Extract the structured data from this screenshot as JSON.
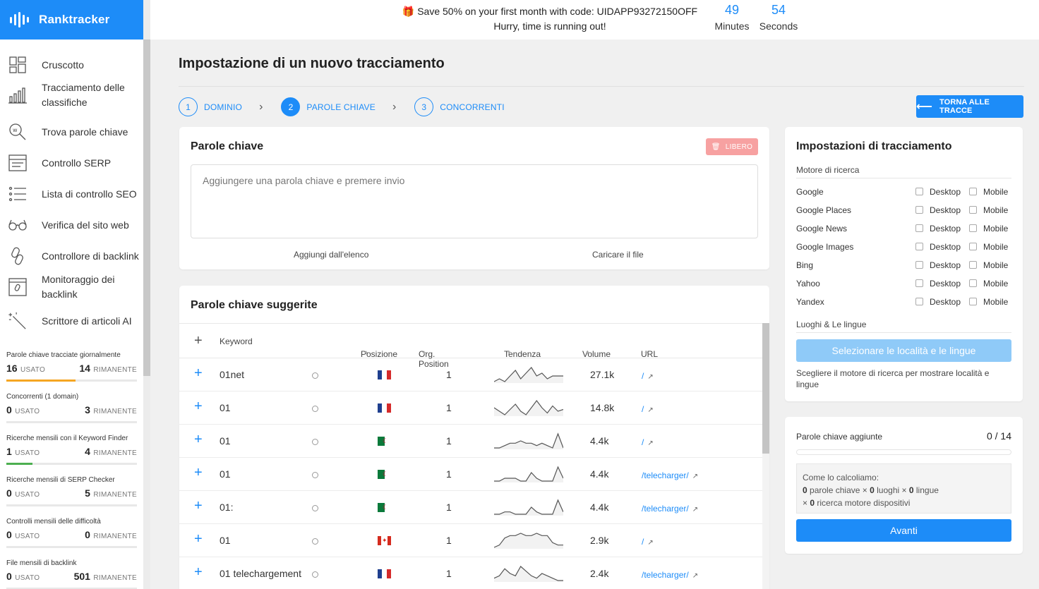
{
  "app": {
    "name": "Ranktracker"
  },
  "promo": {
    "line1": "Save 50% on your first month with code: UIDAPP93272150OFF",
    "line2": "Hurry, time is running out!",
    "minutes_value": "49",
    "minutes_label": "Minutes",
    "seconds_value": "54",
    "seconds_label": "Seconds"
  },
  "sidebar": {
    "items": [
      {
        "label": "Cruscotto",
        "icon": "dashboard-icon"
      },
      {
        "label": "Tracciamento delle classifiche",
        "icon": "bar-chart-icon"
      },
      {
        "label": "Trova parole chiave",
        "icon": "keyword-search-icon"
      },
      {
        "label": "Controllo SERP",
        "icon": "serp-icon"
      },
      {
        "label": "Lista di controllo SEO",
        "icon": "checklist-icon"
      },
      {
        "label": "Verifica del sito web",
        "icon": "glasses-icon"
      },
      {
        "label": "Controllore di backlink",
        "icon": "link-icon"
      },
      {
        "label": "Monitoraggio dei backlink",
        "icon": "backlink-monitor-icon"
      },
      {
        "label": "Scrittore di articoli AI",
        "icon": "magic-wand-icon"
      }
    ],
    "quotas": [
      {
        "title": "Parole chiave tracciate giornalmente",
        "used": "16",
        "used_label": "USATO",
        "remaining": "14",
        "remaining_label": "RIMANENTE",
        "used_fraction": 0.53,
        "bar_color": "#f5a623"
      },
      {
        "title": "Concorrenti (1 domain)",
        "used": "0",
        "used_label": "USATO",
        "remaining": "3",
        "remaining_label": "RIMANENTE",
        "used_fraction": 0,
        "bar_color": "#f5a623"
      },
      {
        "title": "Ricerche mensili con il Keyword Finder",
        "used": "1",
        "used_label": "USATO",
        "remaining": "4",
        "remaining_label": "RIMANENTE",
        "used_fraction": 0.2,
        "bar_color": "#4caf50"
      },
      {
        "title": "Ricerche mensili di SERP Checker",
        "used": "0",
        "used_label": "USATO",
        "remaining": "5",
        "remaining_label": "RIMANENTE",
        "used_fraction": 0,
        "bar_color": "#4caf50"
      },
      {
        "title": "Controlli mensili delle difficoltà",
        "used": "0",
        "used_label": "USATO",
        "remaining": "0",
        "remaining_label": "RIMANENTE",
        "used_fraction": 0,
        "bar_color": "#4caf50"
      },
      {
        "title": "File mensili di backlink",
        "used": "0",
        "used_label": "USATO",
        "remaining": "501",
        "remaining_label": "RIMANENTE",
        "used_fraction": 0,
        "bar_color": "#4caf50"
      }
    ]
  },
  "page": {
    "title": "Impostazione di un nuovo tracciamento",
    "steps": [
      {
        "num": "1",
        "label": "DOMINIO"
      },
      {
        "num": "2",
        "label": "PAROLE CHIAVE"
      },
      {
        "num": "3",
        "label": "CONCORRENTI"
      }
    ],
    "active_step": 2,
    "back_button": "TORNA ALLE TRACCE"
  },
  "keywords_card": {
    "title": "Parole chiave",
    "badge": "LIBERO",
    "placeholder": "Aggiungere una parola chiave e premere invio",
    "link_list": "Aggiungi dall'elenco",
    "link_file": "Caricare il file"
  },
  "suggested": {
    "title": "Parole chiave suggerite",
    "columns": {
      "keyword": "Keyword",
      "position": "Posizione",
      "org_position": "Org. Position",
      "trend": "Tendenza",
      "volume": "Volume",
      "url": "URL"
    },
    "rows": [
      {
        "keyword": "01net",
        "flag": "fr",
        "org": "1",
        "volume": "27.1k",
        "url": "/",
        "trend": [
          5,
          6,
          5,
          7,
          9,
          6,
          8,
          10,
          7,
          8,
          6,
          7,
          7,
          7
        ]
      },
      {
        "keyword": "01",
        "flag": "fr",
        "org": "1",
        "volume": "14.8k",
        "url": "/",
        "trend": [
          6,
          4,
          2,
          5,
          8,
          4,
          2,
          6,
          10,
          6,
          3,
          7,
          4,
          5
        ]
      },
      {
        "keyword": "01",
        "flag": "dz",
        "org": "1",
        "volume": "4.4k",
        "url": "/",
        "trend": [
          2,
          2,
          3,
          4,
          4,
          5,
          4,
          4,
          3,
          4,
          3,
          2,
          8,
          2
        ]
      },
      {
        "keyword": "01",
        "flag": "dz",
        "org": "1",
        "volume": "4.4k",
        "url": "/telecharger/",
        "trend": [
          2,
          2,
          3,
          3,
          3,
          2,
          2,
          5,
          3,
          2,
          2,
          2,
          7,
          3
        ]
      },
      {
        "keyword": "01:",
        "flag": "dz",
        "org": "1",
        "volume": "4.4k",
        "url": "/telecharger/",
        "trend": [
          2,
          2,
          3,
          3,
          2,
          2,
          2,
          5,
          3,
          2,
          2,
          2,
          8,
          3
        ]
      },
      {
        "keyword": "01",
        "flag": "ca",
        "org": "1",
        "volume": "2.9k",
        "url": "/",
        "trend": [
          2,
          3,
          6,
          7,
          7,
          8,
          7,
          7,
          8,
          7,
          7,
          4,
          3,
          3
        ]
      },
      {
        "keyword": "01 telechargement",
        "flag": "fr",
        "org": "1",
        "volume": "2.4k",
        "url": "/telecharger/",
        "trend": [
          4,
          5,
          8,
          6,
          5,
          9,
          7,
          5,
          4,
          6,
          5,
          4,
          3,
          3
        ]
      }
    ]
  },
  "settings": {
    "title": "Impostazioni di tracciamento",
    "engines_label": "Motore di ricerca",
    "desktop_label": "Desktop",
    "mobile_label": "Mobile",
    "engines": [
      "Google",
      "Google Places",
      "Google News",
      "Google Images",
      "Bing",
      "Yahoo",
      "Yandex"
    ],
    "locations_label": "Luoghi & Le lingue",
    "locations_button": "Selezionare le località e le lingue",
    "locations_hint": "Scegliere il motore di ricerca per mostrare località e lingue"
  },
  "summary": {
    "label": "Parole chiave aggiunte",
    "value": "0 / 14",
    "calc_title": "Come lo calcoliamo:",
    "calc_line1_a": "0",
    "calc_line1_b": "parole chiave ×",
    "calc_line1_c": "0",
    "calc_line1_d": "luoghi ×",
    "calc_line1_e": "0",
    "calc_line1_f": "lingue",
    "calc_line2_a": "×",
    "calc_line2_b": "0",
    "calc_line2_c": "ricerca motore dispositivi",
    "next_button": "Avanti"
  },
  "colors": {
    "accent": "#1d8cf8",
    "accent_light": "#8fcaf8",
    "badge": "#f7a1a1"
  }
}
